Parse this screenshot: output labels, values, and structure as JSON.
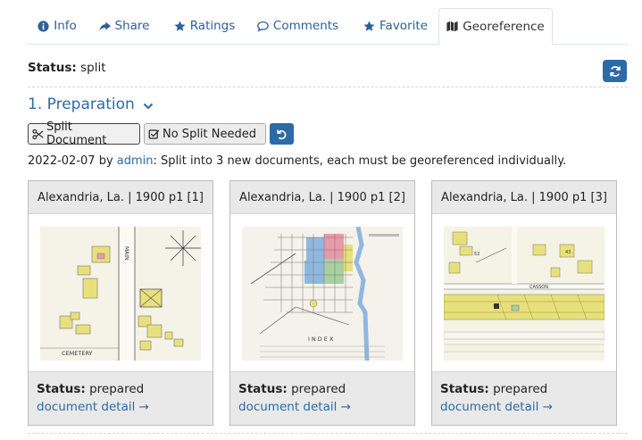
{
  "tabs": [
    {
      "label": "Info"
    },
    {
      "label": "Share"
    },
    {
      "label": "Ratings"
    },
    {
      "label": "Comments"
    },
    {
      "label": "Favorite"
    },
    {
      "label": "Georeference"
    }
  ],
  "status": {
    "label": "Status:",
    "value": "split"
  },
  "preparation": {
    "heading": "1. Preparation"
  },
  "buttons": {
    "split": "Split Document",
    "no_split": "No Split Needed"
  },
  "log": {
    "date": "2022-02-07",
    "by": "by",
    "user": "admin",
    "message": ": Split into 3 new documents, each must be georeferenced individually."
  },
  "documents": [
    {
      "title": "Alexandria, La. | 1900 p1 [1]",
      "status_label": "Status:",
      "status": "prepared",
      "link": "document detail →"
    },
    {
      "title": "Alexandria, La. | 1900 p1 [2]",
      "status_label": "Status:",
      "status": "prepared",
      "link": "document detail →"
    },
    {
      "title": "Alexandria, La. | 1900 p1 [3]",
      "status_label": "Status:",
      "status": "prepared",
      "link": "document detail →"
    }
  ],
  "map_labels": {
    "doc1": [
      "MAIN",
      "CEMETERY"
    ],
    "doc2": [
      "INDEX"
    ],
    "doc3": [
      "CASSON",
      "52",
      "43"
    ]
  },
  "colors": {
    "link": "#2c6aa8",
    "primary_button": "#2c6aa8",
    "map_yellow": "#e8e07a",
    "map_pink": "#e89aa8",
    "map_blue": "#8fb8e0",
    "map_green": "#a8d0a0"
  }
}
